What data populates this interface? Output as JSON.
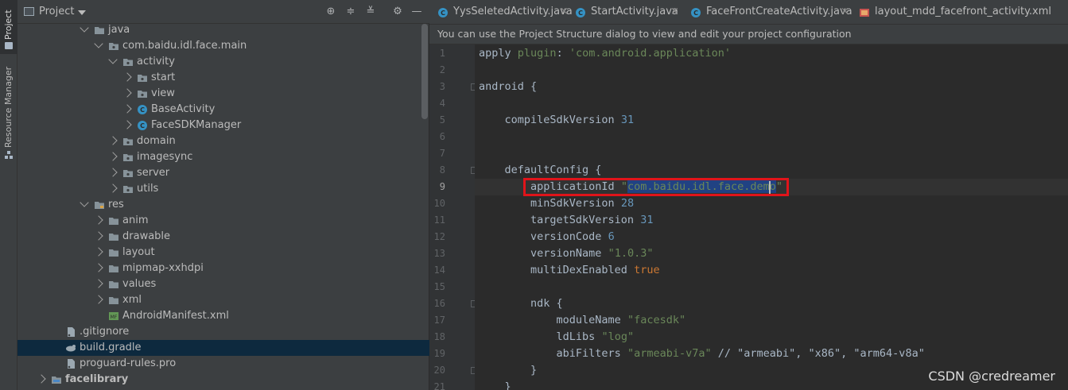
{
  "tool_stripe": {
    "project_label": "Project",
    "resource_label": "Resource Manager"
  },
  "project_panel": {
    "title": "Project",
    "tree": [
      {
        "label": "java",
        "depth": 0,
        "expanded": true,
        "icon": "folder-icon"
      },
      {
        "label": "com.baidu.idl.face.main",
        "depth": 1,
        "expanded": true,
        "icon": "package-icon"
      },
      {
        "label": "activity",
        "depth": 2,
        "expanded": true,
        "icon": "package-icon"
      },
      {
        "label": "start",
        "depth": 3,
        "expanded": false,
        "icon": "package-icon"
      },
      {
        "label": "view",
        "depth": 3,
        "expanded": false,
        "icon": "package-icon"
      },
      {
        "label": "BaseActivity",
        "depth": 3,
        "expanded": false,
        "icon": "class-icon"
      },
      {
        "label": "FaceSDKManager",
        "depth": 3,
        "expanded": false,
        "icon": "class-icon"
      },
      {
        "label": "domain",
        "depth": 2,
        "expanded": false,
        "icon": "package-icon"
      },
      {
        "label": "imagesync",
        "depth": 2,
        "expanded": false,
        "icon": "package-icon"
      },
      {
        "label": "server",
        "depth": 2,
        "expanded": false,
        "icon": "package-icon"
      },
      {
        "label": "utils",
        "depth": 2,
        "expanded": false,
        "icon": "package-icon"
      },
      {
        "label": "res",
        "depth": 0,
        "expanded": true,
        "icon": "res-folder-icon"
      },
      {
        "label": "anim",
        "depth": 1,
        "expanded": false,
        "icon": "folder-icon"
      },
      {
        "label": "drawable",
        "depth": 1,
        "expanded": false,
        "icon": "folder-icon"
      },
      {
        "label": "layout",
        "depth": 1,
        "expanded": false,
        "icon": "folder-icon"
      },
      {
        "label": "mipmap-xxhdpi",
        "depth": 1,
        "expanded": false,
        "icon": "folder-icon"
      },
      {
        "label": "values",
        "depth": 1,
        "expanded": false,
        "icon": "folder-icon"
      },
      {
        "label": "xml",
        "depth": 1,
        "expanded": false,
        "icon": "folder-icon"
      },
      {
        "label": "AndroidManifest.xml",
        "depth": 1,
        "expanded": null,
        "icon": "manifest-icon"
      },
      {
        "label": ".gitignore",
        "depth": -1,
        "expanded": null,
        "icon": "file-icon"
      },
      {
        "label": "build.gradle",
        "depth": -1,
        "expanded": null,
        "icon": "gradle-icon",
        "selected": true
      },
      {
        "label": "proguard-rules.pro",
        "depth": -1,
        "expanded": null,
        "icon": "file-icon"
      },
      {
        "label": "facelibrary",
        "depth": -2,
        "expanded": false,
        "icon": "module-icon",
        "bold": true
      }
    ]
  },
  "editor": {
    "tabs": [
      {
        "label": "YysSeletedActivity.java"
      },
      {
        "label": "StartActivity.java"
      },
      {
        "label": "FaceFrontCreateActivity.java"
      },
      {
        "label": "layout_mdd_facefront_activity.xml"
      }
    ],
    "banner": "You can use the Project Structure dialog to view and edit your project configuration",
    "current_line": 9,
    "lines": [
      {
        "n": "1",
        "parts": [
          [
            "plain",
            "apply "
          ],
          [
            "str",
            "plugin"
          ],
          [
            "plain",
            ": "
          ],
          [
            "str",
            "'com.android.application'"
          ]
        ]
      },
      {
        "n": "2",
        "parts": []
      },
      {
        "n": "3",
        "parts": [
          [
            "plain",
            "android {"
          ]
        ]
      },
      {
        "n": "4",
        "parts": []
      },
      {
        "n": "5",
        "parts": [
          [
            "plain",
            "    compileSdkVersion "
          ],
          [
            "num",
            "31"
          ]
        ]
      },
      {
        "n": "6",
        "parts": []
      },
      {
        "n": "7",
        "parts": []
      },
      {
        "n": "8",
        "parts": [
          [
            "plain",
            "    defaultConfig {"
          ]
        ]
      },
      {
        "n": "9",
        "parts": [
          [
            "plain",
            "        applicationId "
          ],
          [
            "str",
            "\""
          ],
          [
            "sel",
            "com.baidu.idl.face.demo"
          ],
          [
            "str",
            "\""
          ]
        ]
      },
      {
        "n": "10",
        "parts": [
          [
            "plain",
            "        minSdkVersion "
          ],
          [
            "num",
            "28"
          ]
        ]
      },
      {
        "n": "11",
        "parts": [
          [
            "plain",
            "        targetSdkVersion "
          ],
          [
            "num",
            "31"
          ]
        ]
      },
      {
        "n": "12",
        "parts": [
          [
            "plain",
            "        versionCode "
          ],
          [
            "num",
            "6"
          ]
        ]
      },
      {
        "n": "13",
        "parts": [
          [
            "plain",
            "        versionName "
          ],
          [
            "str",
            "\"1.0.3\""
          ]
        ]
      },
      {
        "n": "14",
        "parts": [
          [
            "plain",
            "        multiDexEnabled "
          ],
          [
            "kw",
            "true"
          ]
        ]
      },
      {
        "n": "15",
        "parts": []
      },
      {
        "n": "16",
        "parts": [
          [
            "plain",
            "        ndk {"
          ]
        ]
      },
      {
        "n": "17",
        "parts": [
          [
            "plain",
            "            moduleName "
          ],
          [
            "str",
            "\"facesdk\""
          ]
        ]
      },
      {
        "n": "18",
        "parts": [
          [
            "plain",
            "            ldLibs "
          ],
          [
            "str",
            "\"log\""
          ]
        ]
      },
      {
        "n": "19",
        "parts": [
          [
            "plain",
            "            abiFilters "
          ],
          [
            "str",
            "\"armeabi-v7a\""
          ],
          [
            "plain",
            " // \"armeabi\", \"x86\", \"arm64-v8a\""
          ]
        ]
      },
      {
        "n": "20",
        "parts": [
          [
            "plain",
            "        }"
          ]
        ]
      },
      {
        "n": "21",
        "parts": [
          [
            "plain",
            "    }"
          ]
        ]
      }
    ]
  },
  "watermark": "CSDN @credreamer"
}
